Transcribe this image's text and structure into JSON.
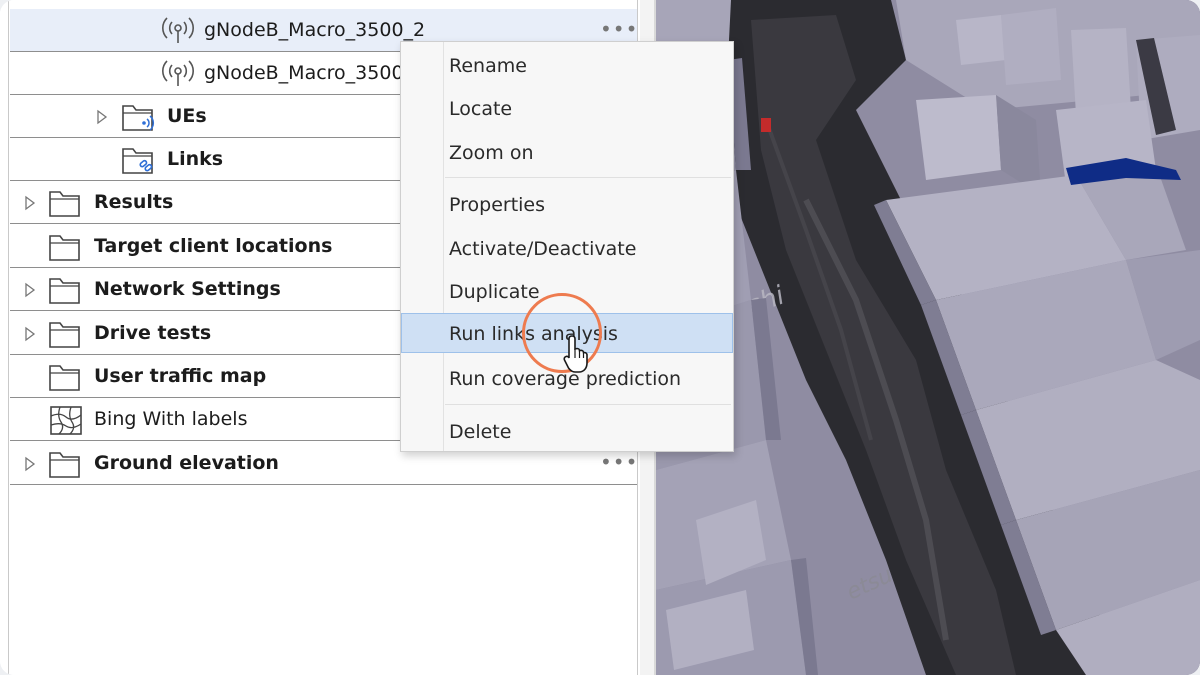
{
  "tree": {
    "rows": [
      {
        "label": "gNodeB_Macro_3500_2"
      },
      {
        "label": "gNodeB_Macro_3500_"
      },
      {
        "label": "UEs"
      },
      {
        "label": "Links"
      },
      {
        "label": "Results"
      },
      {
        "label": "Target client locations"
      },
      {
        "label": "Network Settings"
      },
      {
        "label": "Drive tests"
      },
      {
        "label": "User traffic map"
      },
      {
        "label": "Bing With labels"
      },
      {
        "label": "Ground elevation"
      }
    ],
    "more_glyph": "•••"
  },
  "context_menu": {
    "items": [
      {
        "label": "Rename"
      },
      {
        "label": "Locate"
      },
      {
        "label": "Zoom on"
      },
      {
        "label": "Properties"
      },
      {
        "label": "Activate/Deactivate"
      },
      {
        "label": "Duplicate"
      },
      {
        "label": "Run links analysis"
      },
      {
        "label": "Run coverage prediction"
      },
      {
        "label": "Delete"
      }
    ],
    "hovered_item": "Run links analysis"
  },
  "colors": {
    "selection": "#e8eef9",
    "menu_hover": "#cfe0f4",
    "highlight_ring": "#ee7b4f",
    "map_building": "#a9a7ba",
    "map_street": "#2b2b30"
  },
  "icons": {
    "antenna": "antenna-icon",
    "folder": "folder-icon",
    "folder_ues": "folder-ue-icon",
    "folder_links": "folder-link-icon",
    "bing_map": "map-grid-icon",
    "cursor": "mouse-pointer-icon"
  }
}
